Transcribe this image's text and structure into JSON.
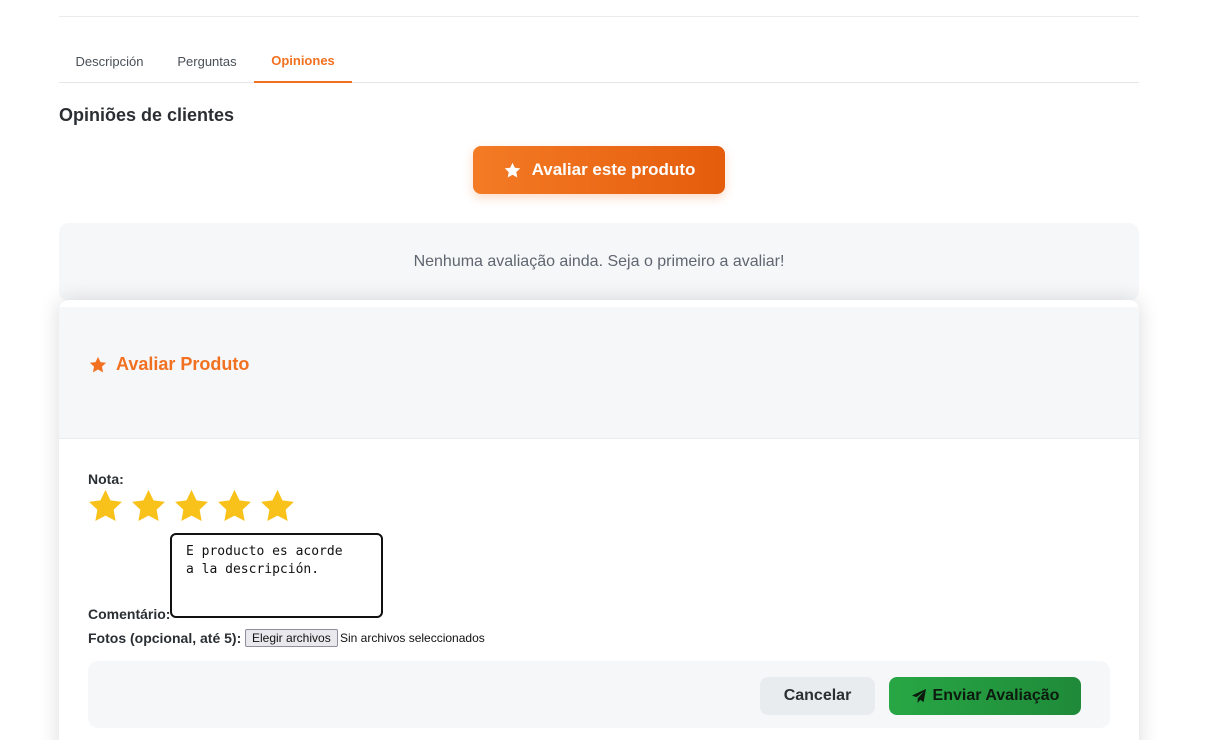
{
  "tabs": [
    {
      "label": "Descripción",
      "active": false
    },
    {
      "label": "Perguntas",
      "active": false
    },
    {
      "label": "Opiniones",
      "active": true
    }
  ],
  "reviews": {
    "section_title": "Opiniões de clientes",
    "rate_button_label": "Avaliar este produto",
    "empty_message": "Nenhuma avaliação ainda. Seja o primeiro a avaliar!"
  },
  "modal": {
    "title": "Avaliar Produto",
    "rating_label": "Nota:",
    "rating_value": 5,
    "rating_max": 5,
    "comment_label": "Comentário:",
    "comment_value": "E producto es acorde\na la descripción.",
    "photos_label": "Fotos (opcional, até 5):",
    "file_button_label": "Elegir archivos",
    "file_status": "Sin archivos seleccionados",
    "cancel_label": "Cancelar",
    "submit_label": "Enviar Avaliação"
  },
  "colors": {
    "accent": "#f27121",
    "star": "#f8c21b",
    "success": "#28a745",
    "panel_bg": "#f6f7f9"
  },
  "icons": {
    "rate_button": "star-icon",
    "modal_title": "star-icon",
    "submit": "paper-plane-icon"
  }
}
